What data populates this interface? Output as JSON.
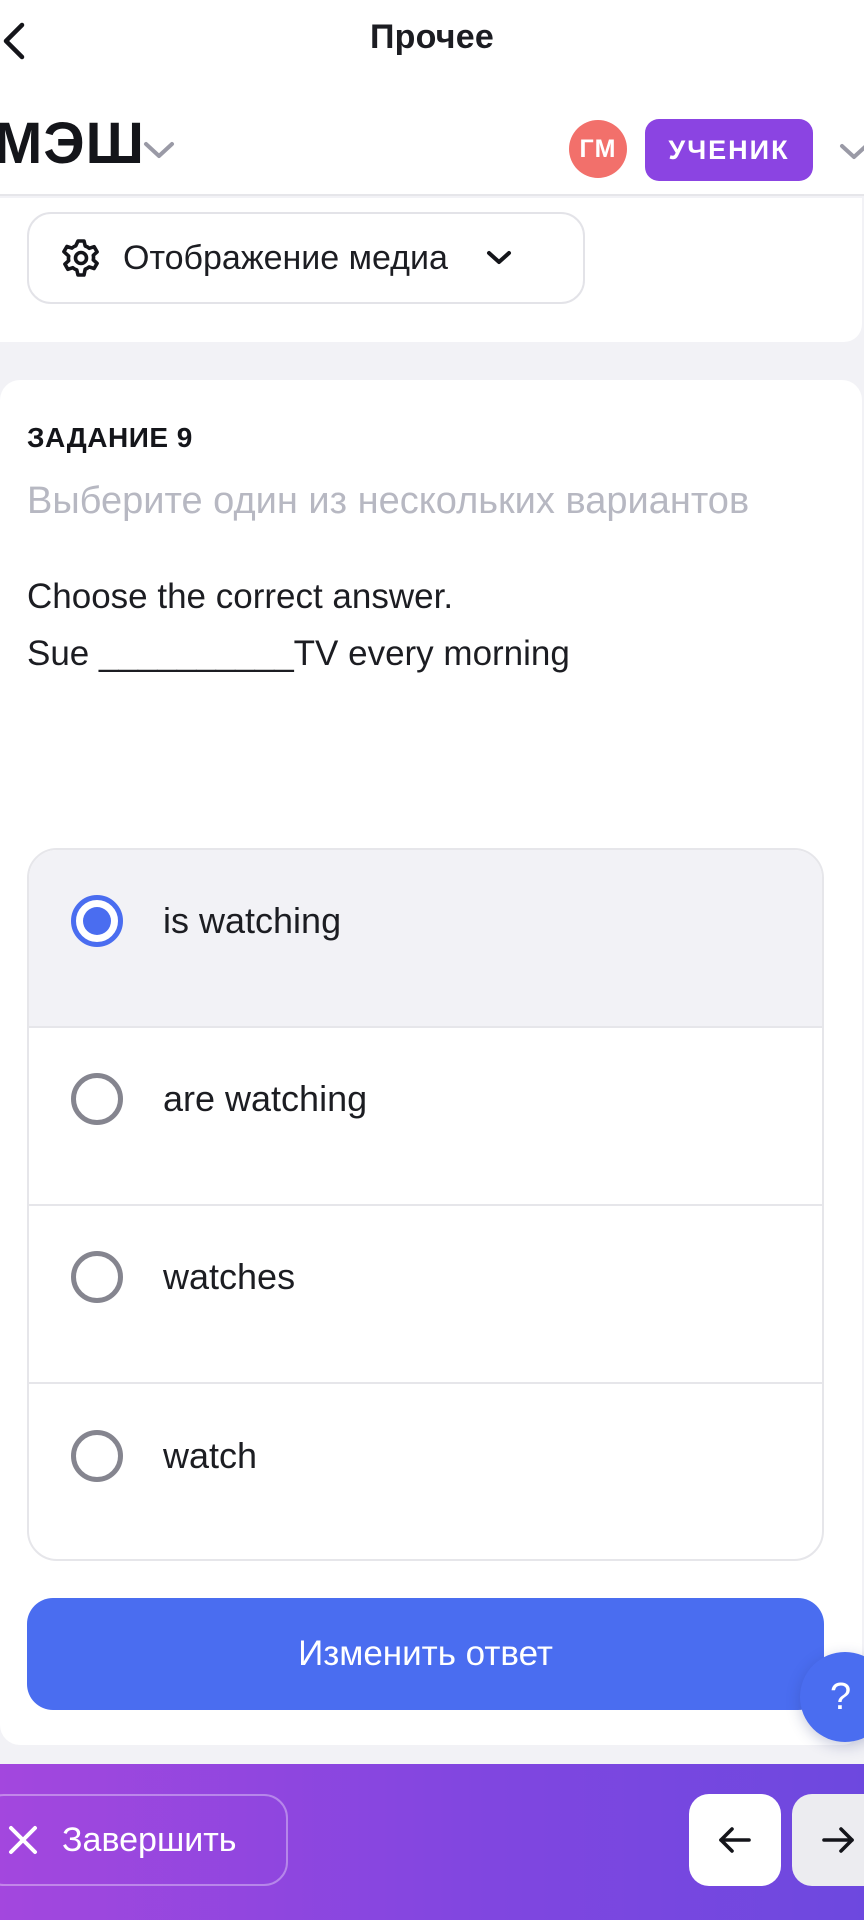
{
  "topbar": {
    "title": "Прочее"
  },
  "header": {
    "logo": "МЭШ",
    "avatar_initials": "ГМ",
    "role_badge": "УЧЕНИК"
  },
  "media": {
    "label": "Отображение медиа"
  },
  "task": {
    "number_label": "ЗАДАНИЕ 9",
    "hint": "Выберите один из нескольких вариантов",
    "question_line1": "Choose the correct answer.",
    "question_line2": "Sue __________TV every morning",
    "options": [
      {
        "label": "is watching",
        "selected": true
      },
      {
        "label": "are watching",
        "selected": false
      },
      {
        "label": "watches",
        "selected": false
      },
      {
        "label": "watch",
        "selected": false
      }
    ],
    "change_button": "Изменить ответ"
  },
  "help": {
    "label": "?"
  },
  "bottom_bar": {
    "finish_label": "Завершить"
  },
  "colors": {
    "accent_blue": "#4a6df0",
    "role_purple": "#8b44e2",
    "avatar_red": "#f2706b",
    "gradient_start": "#a347de",
    "gradient_end": "#6d48df"
  },
  "icons": {
    "back": "chevron-left-icon",
    "logo_dropdown": "chevron-down-icon",
    "media": "gear-icon",
    "media_dropdown": "chevron-down-icon",
    "finish": "close-icon",
    "prev": "arrow-left-icon",
    "next": "arrow-right-icon"
  }
}
